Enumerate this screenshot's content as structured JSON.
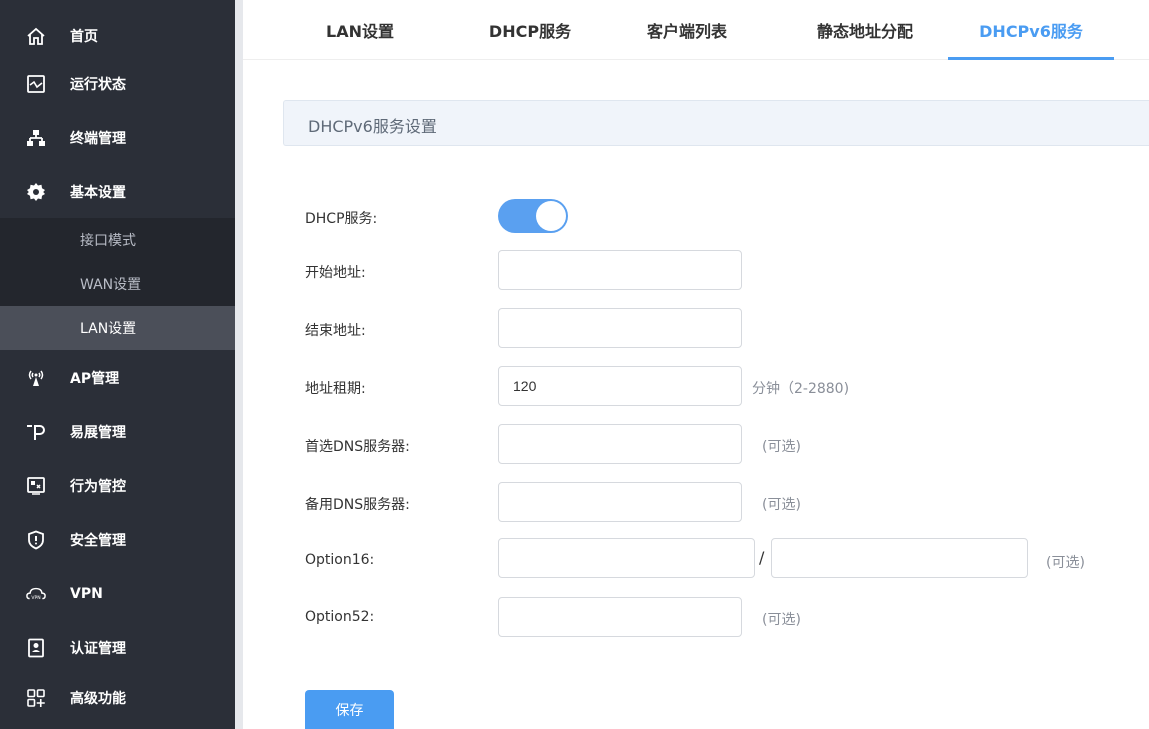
{
  "sidebar": {
    "items": [
      {
        "label": "首页",
        "icon": "home-icon"
      },
      {
        "label": "运行状态",
        "icon": "status-monitor-icon"
      },
      {
        "label": "终端管理",
        "icon": "network-tree-icon"
      },
      {
        "label": "基本设置",
        "icon": "gear-icon"
      },
      {
        "label": "AP管理",
        "icon": "ap-antenna-icon"
      },
      {
        "label": "易展管理",
        "icon": "easy-expand-icon"
      },
      {
        "label": "行为管控",
        "icon": "behavior-control-icon"
      },
      {
        "label": "安全管理",
        "icon": "shield-icon"
      },
      {
        "label": "VPN",
        "icon": "vpn-cloud-icon"
      },
      {
        "label": "认证管理",
        "icon": "auth-badge-icon"
      },
      {
        "label": "高级功能",
        "icon": "advanced-grid-icon"
      }
    ],
    "subitems": [
      {
        "label": "接口模式"
      },
      {
        "label": "WAN设置"
      },
      {
        "label": "LAN设置",
        "active": true
      }
    ]
  },
  "tabs": [
    {
      "label": "LAN设置"
    },
    {
      "label": "DHCP服务"
    },
    {
      "label": "客户端列表"
    },
    {
      "label": "静态地址分配"
    },
    {
      "label": "DHCPv6服务",
      "active": true
    }
  ],
  "panel": {
    "title": "DHCPv6服务设置"
  },
  "form": {
    "dhcp_service": {
      "label": "DHCP服务:",
      "enabled": true
    },
    "start_address": {
      "label": "开始地址:",
      "value": ""
    },
    "end_address": {
      "label": "结束地址:",
      "value": ""
    },
    "lease": {
      "label": "地址租期:",
      "value": "120",
      "hint": "分钟（2-2880)"
    },
    "primary_dns": {
      "label": "首选DNS服务器:",
      "value": "",
      "hint": "(可选)"
    },
    "backup_dns": {
      "label": "备用DNS服务器:",
      "value": "",
      "hint": "(可选)"
    },
    "option16": {
      "label": "Option16:",
      "value1": "",
      "value2": "",
      "separator": "/",
      "hint": "(可选)"
    },
    "option52": {
      "label": "Option52:",
      "value": "",
      "hint": "(可选)"
    }
  },
  "save_label": "保存",
  "colors": {
    "sidebar_bg": "#2b2f38",
    "accent": "#4a9cf2",
    "active_sub_bg": "#4b4f59"
  }
}
